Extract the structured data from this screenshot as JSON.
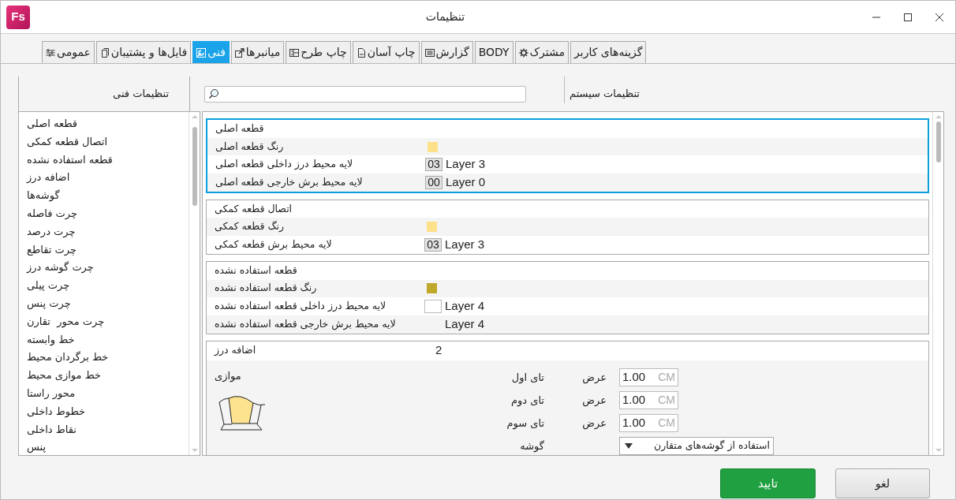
{
  "window": {
    "logo_text": "Fs",
    "title": "تنظیمات"
  },
  "tabs": [
    {
      "label": "گزینه‌های کاربر",
      "selected": false
    },
    {
      "label": "مشترک",
      "kind": "gear",
      "selected": false
    },
    {
      "label": "BODY",
      "selected": false
    },
    {
      "label": "گزارش",
      "kind": "list",
      "selected": false
    },
    {
      "label": "چاپ آسان",
      "kind": "pdf",
      "selected": false
    },
    {
      "label": "چاپ طرح",
      "kind": "layout",
      "selected": false
    },
    {
      "label": "میانبرها",
      "kind": "export",
      "selected": false
    },
    {
      "label": "فنی",
      "kind": "tools",
      "selected": true
    },
    {
      "label": "فایل‌ها و پشتیبان",
      "kind": "page",
      "selected": false
    },
    {
      "label": "عمومی",
      "kind": "sliders",
      "selected": false
    }
  ],
  "sidebar": {
    "title": "تنظیمات فنی",
    "items": [
      "قطعه اصلی",
      "اتصال قطعه کمکی",
      "قطعه استفاده نشده",
      "اضافه درز",
      "گوشه‌ها",
      "چرت فاصله",
      "چرت درصد",
      "چرت تقاطع",
      "چرت گوشه درز",
      "چرت پیلی",
      "چرت پنس",
      "چرت محور  تقارن",
      "خط وابسته",
      "خط برگردان محیط",
      "خط موازی محیط",
      "محور راستا",
      "خطوط داخلی",
      "نقاط داخلی",
      "پنس"
    ]
  },
  "system_label": "تنظیمات سیستم",
  "groups": [
    {
      "title": "قطعه اصلی",
      "selected": true,
      "rows": [
        {
          "kind": "color",
          "label": "رنگ قطعه اصلی",
          "color": "#fde08a"
        },
        {
          "kind": "layer",
          "label": "لایه محیط درز داخلی قطعه اصلی",
          "code": "03",
          "value": "Layer 3"
        },
        {
          "kind": "layer",
          "label": "لایه محیط برش خارجی قطعه اصلی",
          "code": "00",
          "value": "Layer 0"
        }
      ]
    },
    {
      "title": "اتصال قطعه کمکی",
      "selected": false,
      "rows": [
        {
          "kind": "color",
          "label": "رنگ قطعه کمکی",
          "color": "#fde08a"
        },
        {
          "kind": "layer",
          "label": "لایه محیط برش قطعه کمکی",
          "code": "03",
          "value": "Layer 3"
        }
      ]
    },
    {
      "title": "قطعه استفاده نشده",
      "selected": false,
      "rows": [
        {
          "kind": "color",
          "label": "رنگ قطعه استفاده نشده",
          "color": "#c0a82a"
        },
        {
          "kind": "layer_blank",
          "label": "لایه محیط درز داخلی قطعه استفاده نشده",
          "value": "Layer 4"
        },
        {
          "kind": "text",
          "label": "لایه محیط برش خارجی قطعه استفاده نشده",
          "value": "Layer 4"
        }
      ]
    }
  ],
  "seam_allowance": {
    "title": "اضافه درز",
    "value": "2",
    "style": "موازی",
    "widths": [
      {
        "label": "تای اول",
        "field_label": "عرض",
        "value": "1.00",
        "unit": "CM"
      },
      {
        "label": "تای دوم",
        "field_label": "عرض",
        "value": "1.00",
        "unit": "CM"
      },
      {
        "label": "تای سوم",
        "field_label": "عرض",
        "value": "1.00",
        "unit": "CM"
      }
    ],
    "corner": {
      "label": "گوشه",
      "value": "استفاده از گوشه‌های متقارن"
    }
  },
  "buttons": {
    "ok": "تایید",
    "cancel": "لغو"
  }
}
